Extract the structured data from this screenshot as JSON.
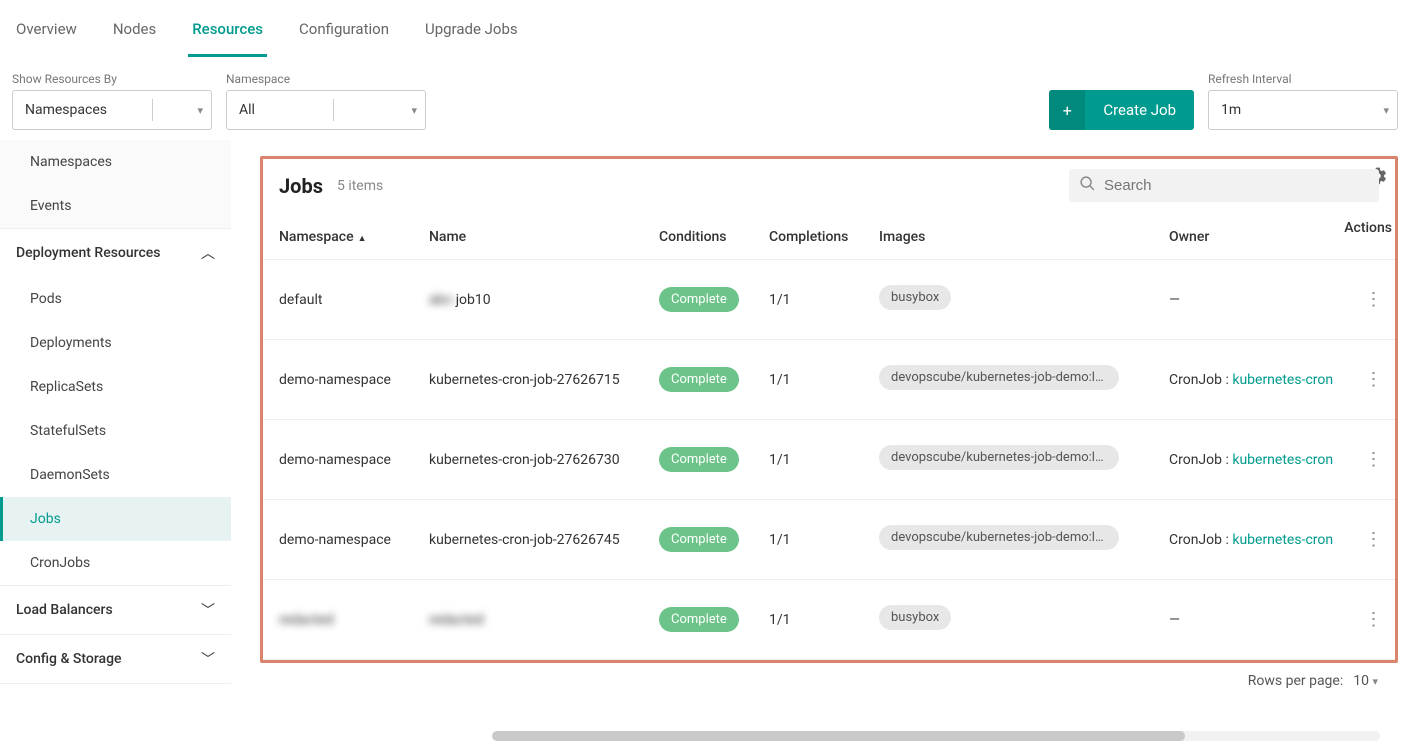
{
  "tabs": [
    "Overview",
    "Nodes",
    "Resources",
    "Configuration",
    "Upgrade Jobs"
  ],
  "active_tab": "Resources",
  "filters": {
    "show_by_label": "Show Resources By",
    "show_by_value": "Namespaces",
    "namespace_label": "Namespace",
    "namespace_value": "All",
    "refresh_label": "Refresh Interval",
    "refresh_value": "1m"
  },
  "create_button": "Create Job",
  "sidebar": {
    "top": [
      "Namespaces",
      "Events"
    ],
    "deployment_label": "Deployment Resources",
    "deployment_items": [
      "Pods",
      "Deployments",
      "ReplicaSets",
      "StatefulSets",
      "DaemonSets",
      "Jobs",
      "CronJobs"
    ],
    "active_item": "Jobs",
    "load_balancers": "Load Balancers",
    "config_storage": "Config & Storage"
  },
  "table": {
    "title": "Jobs",
    "count": "5 items",
    "search_placeholder": "Search",
    "columns": [
      "Namespace",
      "Name",
      "Conditions",
      "Completions",
      "Images",
      "Owner",
      "Actions"
    ],
    "rows": [
      {
        "namespace": "default",
        "name_prefix": "abc-",
        "name": "job10",
        "condition": "Complete",
        "completions": "1/1",
        "image": "busybox",
        "owner_prefix": "",
        "owner_link": "",
        "owner_dash": "—",
        "blur_ns": false,
        "blur_name_prefix": true
      },
      {
        "namespace": "demo-namespace",
        "name_prefix": "",
        "name": "kubernetes-cron-job-27626715",
        "condition": "Complete",
        "completions": "1/1",
        "image": "devopscube/kubernetes-job-demo:lat…",
        "owner_prefix": "CronJob : ",
        "owner_link": "kubernetes-cron",
        "owner_dash": "",
        "blur_ns": false,
        "blur_name_prefix": false
      },
      {
        "namespace": "demo-namespace",
        "name_prefix": "",
        "name": "kubernetes-cron-job-27626730",
        "condition": "Complete",
        "completions": "1/1",
        "image": "devopscube/kubernetes-job-demo:lat…",
        "owner_prefix": "CronJob : ",
        "owner_link": "kubernetes-cron",
        "owner_dash": "",
        "blur_ns": false,
        "blur_name_prefix": false
      },
      {
        "namespace": "demo-namespace",
        "name_prefix": "",
        "name": "kubernetes-cron-job-27626745",
        "condition": "Complete",
        "completions": "1/1",
        "image": "devopscube/kubernetes-job-demo:lat…",
        "owner_prefix": "CronJob : ",
        "owner_link": "kubernetes-cron",
        "owner_dash": "",
        "blur_ns": false,
        "blur_name_prefix": false
      },
      {
        "namespace": "redacted",
        "name_prefix": "",
        "name": "redacted",
        "condition": "Complete",
        "completions": "1/1",
        "image": "busybox",
        "owner_prefix": "",
        "owner_link": "",
        "owner_dash": "—",
        "blur_ns": true,
        "blur_name_prefix": false,
        "blur_name": true
      }
    ]
  },
  "footer": {
    "rows_label": "Rows per page:",
    "rows_value": "10"
  }
}
